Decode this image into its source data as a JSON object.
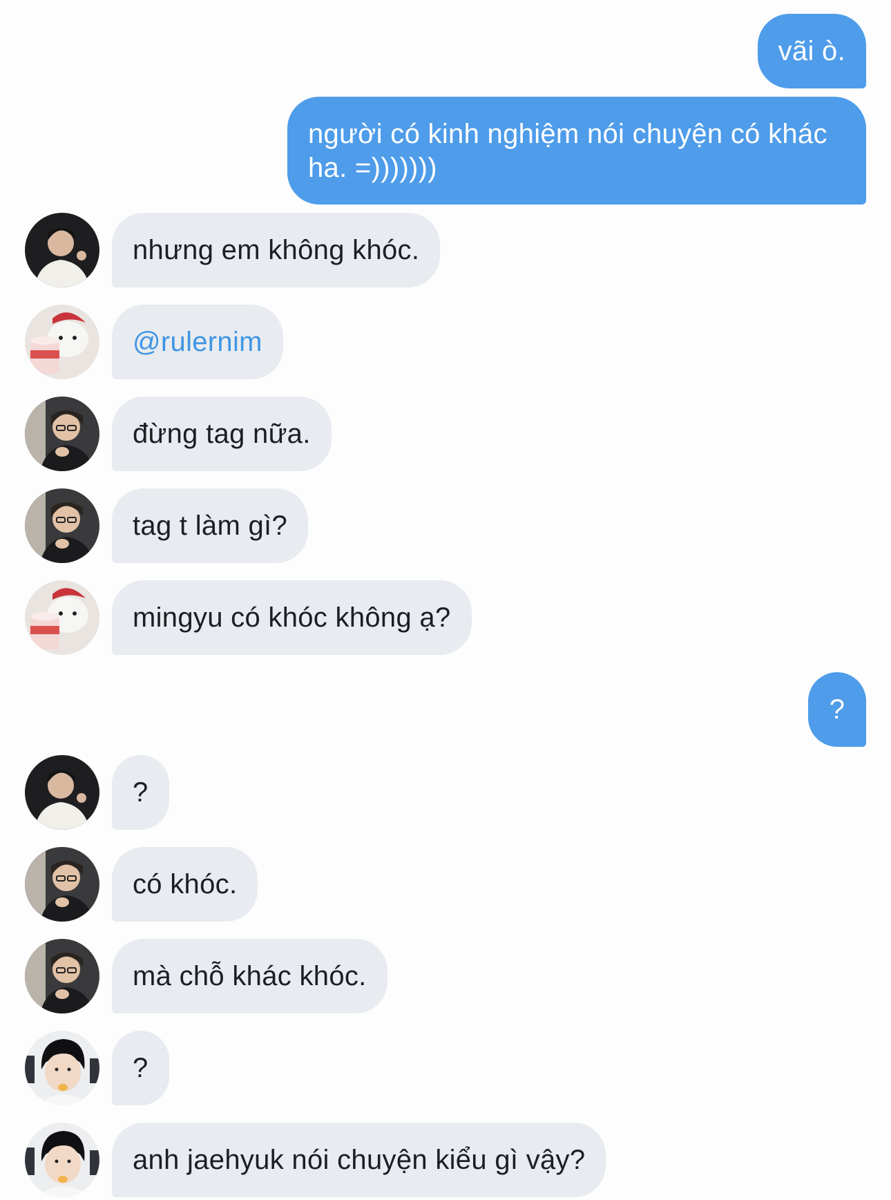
{
  "colors": {
    "outgoing_bubble": "#4e9cea",
    "incoming_bubble": "#e8ebef",
    "mention_text": "#3f95e4",
    "background": "#fdfdfe"
  },
  "messages": [
    {
      "side": "outgoing",
      "text": "vãi ò."
    },
    {
      "side": "outgoing",
      "text": "người có kinh nghiệm nói chuyện có khác ha. =)))))))"
    },
    {
      "side": "incoming",
      "avatar": "avatar-man-white-shirt",
      "text": "nhưng em không khóc."
    },
    {
      "side": "incoming",
      "avatar": "avatar-bear-icecream",
      "text": "@rulernim",
      "mention": true
    },
    {
      "side": "incoming",
      "avatar": "avatar-man-glasses",
      "text": "đừng tag nữa."
    },
    {
      "side": "incoming",
      "avatar": "avatar-man-glasses",
      "text": "tag t làm gì?"
    },
    {
      "side": "incoming",
      "avatar": "avatar-bear-icecream",
      "text": "mingyu có khóc không ạ?"
    },
    {
      "side": "outgoing",
      "text": "?"
    },
    {
      "side": "incoming",
      "avatar": "avatar-man-white-shirt",
      "text": "?"
    },
    {
      "side": "incoming",
      "avatar": "avatar-man-glasses",
      "text": "có khóc."
    },
    {
      "side": "incoming",
      "avatar": "avatar-man-glasses",
      "text": "mà chỗ khác khóc."
    },
    {
      "side": "incoming",
      "avatar": "avatar-boy-headset",
      "text": "?"
    },
    {
      "side": "incoming",
      "avatar": "avatar-boy-headset",
      "text": "anh jaehyuk nói chuyện kiểu gì vậy?"
    }
  ]
}
